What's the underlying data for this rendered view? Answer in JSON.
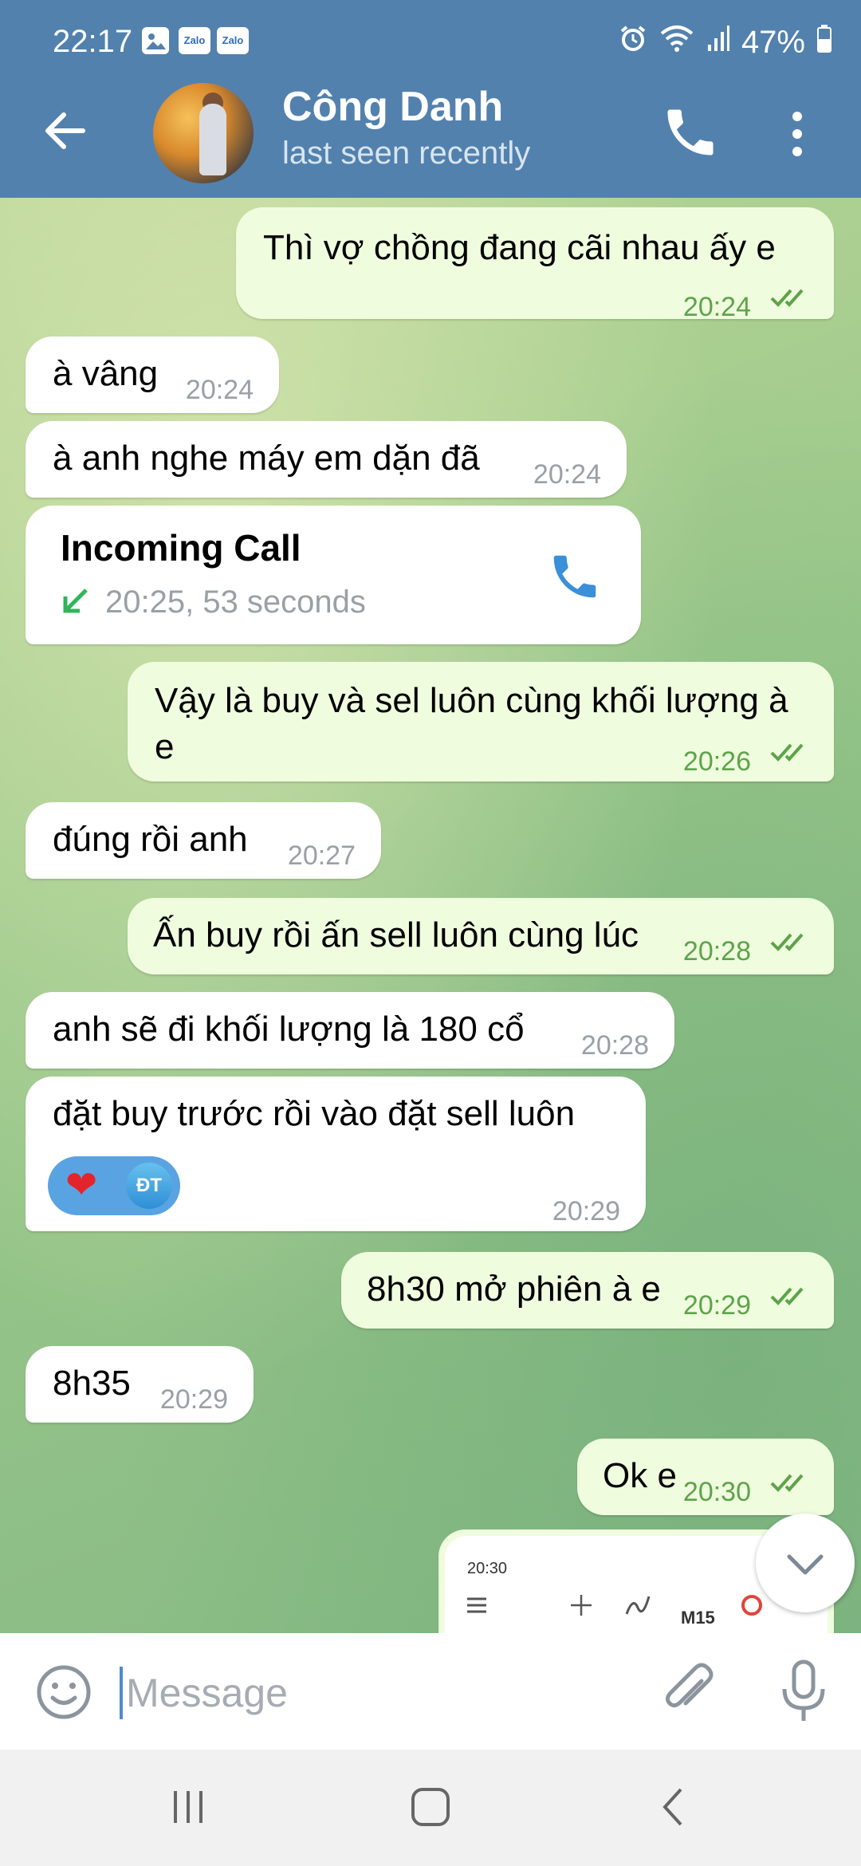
{
  "status_bar": {
    "time": "22:17",
    "notification_icons": [
      "image-icon",
      "zalo-icon",
      "zalo-icon"
    ],
    "zalo_label": "Zalo",
    "battery": "47%"
  },
  "header": {
    "contact_name": "Công Danh",
    "contact_status": "last seen recently"
  },
  "messages": [
    {
      "dir": "out",
      "text": "Thì vợ chồng đang cãi nhau ấy e",
      "time": "20:24",
      "read": true
    },
    {
      "dir": "in",
      "text": "à vâng",
      "time": "20:24"
    },
    {
      "dir": "in",
      "text": "à anh nghe máy em dặn đã",
      "time": "20:24"
    },
    {
      "dir": "in",
      "type": "call",
      "title": "Incoming Call",
      "meta": "20:25, 53 seconds"
    },
    {
      "dir": "out",
      "text": "Vậy là buy và sel luôn cùng khối lượng à e",
      "time": "20:26",
      "read": true
    },
    {
      "dir": "in",
      "text": "đúng rồi anh",
      "time": "20:27"
    },
    {
      "dir": "out",
      "text": "Ấn buy rồi ấn sell luôn cùng lúc",
      "time": "20:28",
      "read": true
    },
    {
      "dir": "in",
      "text": "anh sẽ đi khối lượng là 180 cổ",
      "time": "20:28"
    },
    {
      "dir": "in",
      "text": "đặt buy trước rồi vào đặt sell luôn",
      "time": "20:29",
      "reaction": {
        "emoji": "❤",
        "user_initials": "ĐT"
      }
    },
    {
      "dir": "out",
      "text": "8h30 mở phiên à e",
      "time": "20:29",
      "read": true
    },
    {
      "dir": "in",
      "text": "8h35",
      "time": "20:29"
    },
    {
      "dir": "out",
      "text": "Ok e",
      "time": "20:30",
      "read": true
    }
  ],
  "preview": {
    "time": "20:30",
    "timeframe": "M15"
  },
  "input": {
    "placeholder": "Message"
  },
  "colors": {
    "header": "#5281ae",
    "outgoing_bubble": "#effdde",
    "incoming_bubble": "#ffffff",
    "outgoing_time": "#5ea34a",
    "call_icon": "#3a8fd9",
    "call_arrow": "#2fb55a"
  }
}
